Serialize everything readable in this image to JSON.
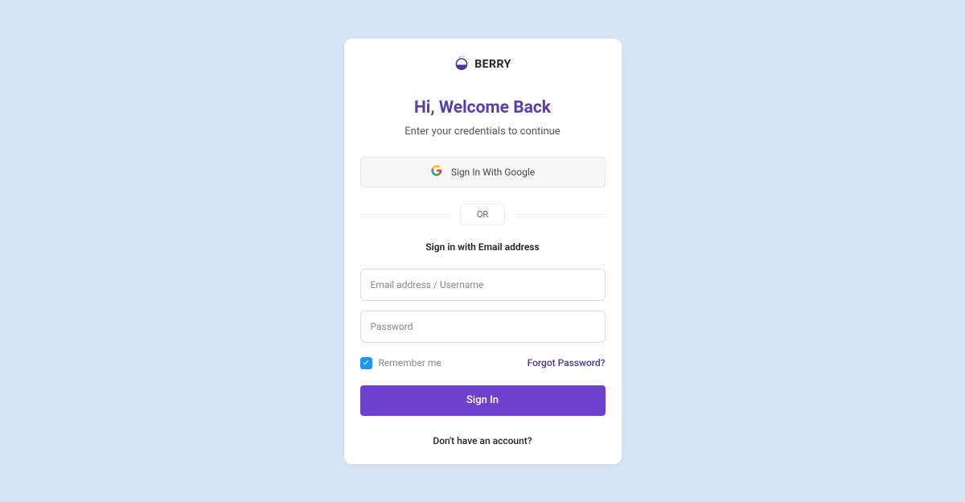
{
  "brand": {
    "name": "BERRY"
  },
  "header": {
    "welcome": "Hi, Welcome Back",
    "subtitle": "Enter your credentials to continue"
  },
  "sso": {
    "google_label": "Sign In With Google"
  },
  "divider": {
    "or": "OR"
  },
  "form": {
    "email_heading": "Sign in with Email address",
    "email_placeholder": "Email address / Username",
    "password_placeholder": "Password",
    "remember_label": "Remember me",
    "forgot_label": "Forgot Password?",
    "signin_label": "Sign In"
  },
  "footer": {
    "no_account": "Don't have an account?"
  },
  "colors": {
    "page_bg": "#D6E4F6",
    "primary": "#6F3FD0",
    "heading": "#5B3EAE",
    "checkbox": "#2096F3"
  }
}
